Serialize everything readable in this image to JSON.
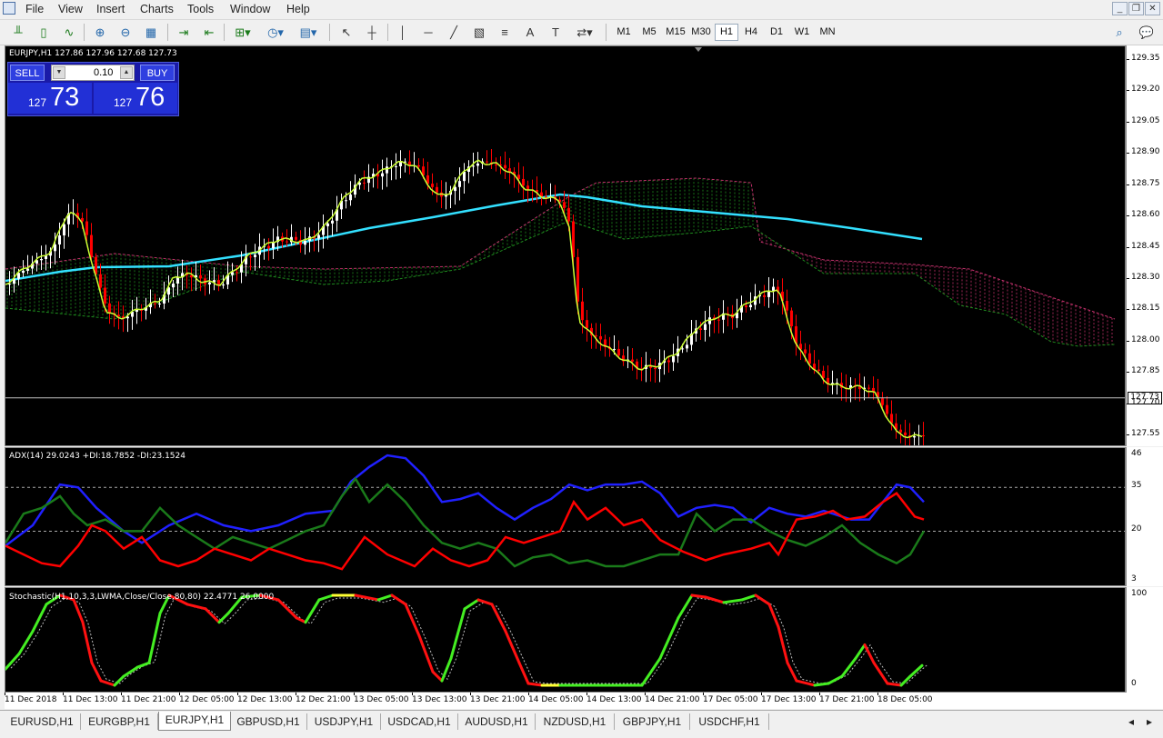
{
  "menu": [
    "File",
    "View",
    "Insert",
    "Charts",
    "Tools",
    "Window",
    "Help"
  ],
  "timeframes": [
    "M1",
    "M5",
    "M15",
    "M30",
    "H1",
    "H4",
    "D1",
    "W1",
    "MN"
  ],
  "active_timeframe": "H1",
  "chart": {
    "header": "EURJPY,H1  127.86 127.96 127.68 127.73",
    "current_price_label": "127.73",
    "price_axis": [
      "129.35",
      "129.20",
      "129.05",
      "128.90",
      "128.75",
      "128.60",
      "128.45",
      "128.30",
      "128.15",
      "128.00",
      "127.85",
      "127.70",
      "127.55"
    ],
    "colors": {
      "bull": "#ffffff",
      "bear": "#ff0000",
      "ma_fast": "#ccff33",
      "ma_slow": "#33e0ff",
      "cloud_green": "#1e8c1e",
      "cloud_red": "#c0306a"
    }
  },
  "one_click": {
    "sell_label": "SELL",
    "buy_label": "BUY",
    "lot": "0.10",
    "sell_big": "127",
    "sell_small": "73",
    "buy_big": "127",
    "buy_small": "76"
  },
  "adx": {
    "label": "ADX(14) 29.0243 +DI:18.7852 -DI:23.1524",
    "levels": [
      "46",
      "35",
      "20",
      "3"
    ]
  },
  "stoch": {
    "label": "Stochastic(H1,10,3,3,LWMA,Close/Close,80,80) 22.4771 26.0000",
    "levels": [
      "100",
      "0"
    ]
  },
  "time_axis": [
    "11 Dec 2018",
    "11 Dec 13:00",
    "11 Dec 21:00",
    "12 Dec 05:00",
    "12 Dec 13:00",
    "12 Dec 21:00",
    "13 Dec 05:00",
    "13 Dec 13:00",
    "13 Dec 21:00",
    "14 Dec 05:00",
    "14 Dec 13:00",
    "14 Dec 21:00",
    "17 Dec 05:00",
    "17 Dec 13:00",
    "17 Dec 21:00",
    "18 Dec 05:00"
  ],
  "tabs": [
    "EURUSD,H1",
    "EURGBP,H1",
    "EURJPY,H1",
    "GBPUSD,H1",
    "USDJPY,H1",
    "USDCAD,H1",
    "AUDUSD,H1",
    "NZDUSD,H1",
    "GBPJPY,H1",
    "USDCHF,H1"
  ],
  "active_tab": "EURJPY,H1"
}
